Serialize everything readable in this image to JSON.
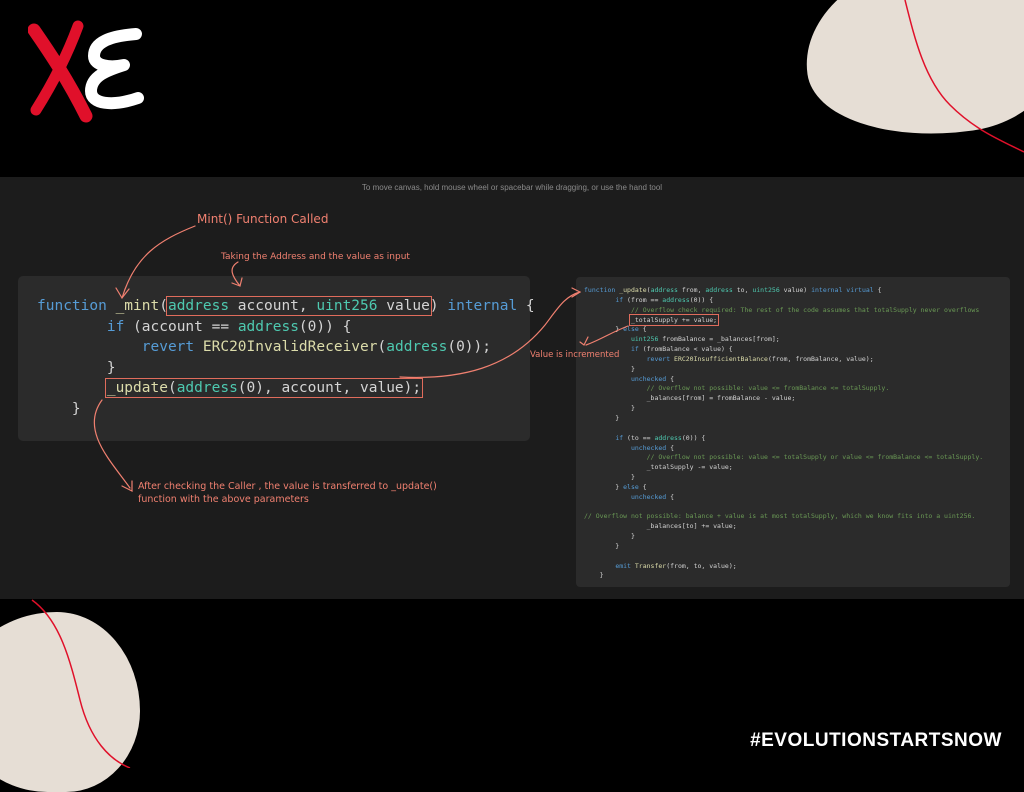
{
  "brand": {
    "logo_alt": "XE"
  },
  "canvas": {
    "hint": "To move canvas, hold mouse wheel or spacebar while dragging, or use the hand tool"
  },
  "annotations": {
    "mint_called": "Mint() Function Called",
    "taking_input": "Taking the Address and the value as input",
    "value_incremented": "Value is incremented",
    "after_checking": "After checking the Caller , the value is transferred to _update() function with the above parameters"
  },
  "code_left": [
    "function _mint(address account, uint256 value) internal {",
    "    if (account == address(0)) {",
    "        revert ERC20InvalidReceiver(address(0));",
    "    }",
    "    _update(address(0), account, value);",
    "}"
  ],
  "code_right": [
    "function _update(address from, address to, uint256 value) internal virtual {",
    "    if (from == address(0)) {",
    "        // Overflow check required: The rest of the code assumes that totalSupply never overflows",
    "        _totalSupply += value;",
    "    } else {",
    "        uint256 fromBalance = _balances[from];",
    "        if (fromBalance < value) {",
    "            revert ERC20InsufficientBalance(from, fromBalance, value);",
    "        }",
    "        unchecked {",
    "            // Overflow not possible: value <= fromBalance <= totalSupply.",
    "            _balances[from] = fromBalance - value;",
    "        }",
    "    }",
    "",
    "    if (to == address(0)) {",
    "        unchecked {",
    "            // Overflow not possible: value <= totalSupply or value <= fromBalance <= totalSupply.",
    "            _totalSupply -= value;",
    "        }",
    "    } else {",
    "        unchecked {",
    "",
    "// Overflow not possible: balance + value is at most totalSupply, which we know fits into a uint256.",
    "            _balances[to] += value;",
    "        }",
    "    }",
    "",
    "    emit Transfer(from, to, value);",
    "}"
  ],
  "footer": {
    "hashtag": "#EVOLUTIONSTARTSNOW"
  },
  "colors": {
    "annotation": "#f08070",
    "accent_red": "#e0102a",
    "blob": "#e6ded5",
    "canvas_bg": "#1c1c1c",
    "card_bg": "#2b2b2b"
  }
}
